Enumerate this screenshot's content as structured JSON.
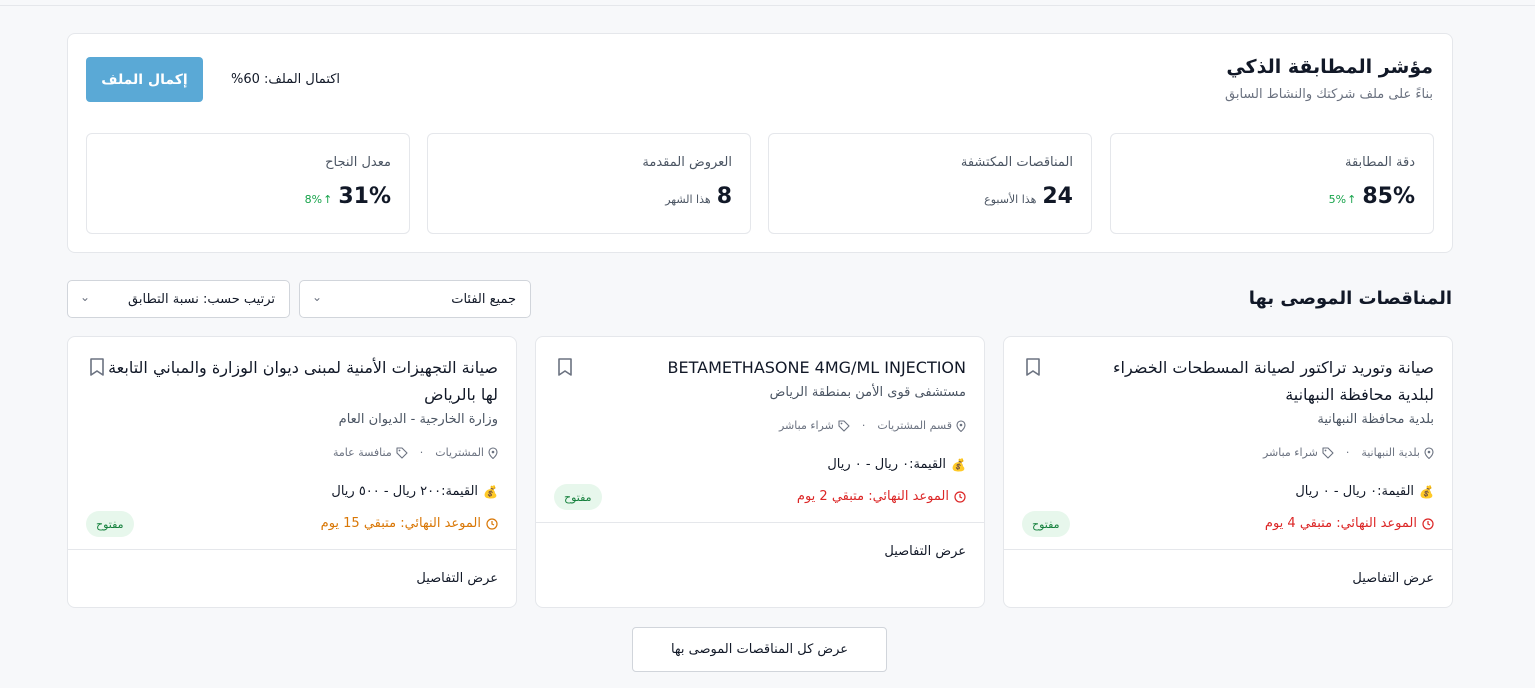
{
  "matching": {
    "title": "مؤشر المطابقة الذكي",
    "subtitle": "بناءً على ملف شركتك والنشاط السابق",
    "completion_label": "اكتمال الملف: 60%",
    "complete_button": "إكمال الملف"
  },
  "stats": [
    {
      "label": "دقة المطابقة",
      "value": "85%",
      "delta": "5%"
    },
    {
      "label": "المناقصات المكتشفة",
      "value": "24",
      "note": "هذا الأسبوع"
    },
    {
      "label": "العروض المقدمة",
      "value": "8",
      "note": "هذا الشهر"
    },
    {
      "label": "معدل النجاح",
      "value": "31%",
      "delta": "8%"
    }
  ],
  "section": {
    "title": "المناقصات الموصى بها",
    "category_filter": "جميع الفئات",
    "sort_filter": "ترتيب حسب: نسبة التطابق"
  },
  "cards": [
    {
      "title": "صيانة وتوريد تراكتور لصيانة المسطحات الخضراء لبلدية محافظة النبهانية",
      "org": "بلدية محافظة النبهانية",
      "location": "بلدية النبهانية",
      "type": "شراء مباشر",
      "value": "القيمة:٠ ريال - ٠ ريال",
      "deadline": "الموعد النهائي: متبقي 4 يوم",
      "deadline_color": "#dc2626",
      "status": "مفتوح",
      "details": "عرض التفاصيل"
    },
    {
      "title": "BETAMETHASONE 4MG/ML INJECTION",
      "org": "مستشفى قوى الأمن بمنطقة الرياض",
      "location": "قسم المشتريات",
      "type": "شراء مباشر",
      "value": "القيمة:٠ ريال - ٠ ريال",
      "deadline": "الموعد النهائي: متبقي 2 يوم",
      "deadline_color": "#dc2626",
      "status": "مفتوح",
      "details": "عرض التفاصيل"
    },
    {
      "title": "صيانة التجهيزات الأمنية لمبنى ديوان الوزارة والمباني التابعة لها بالرياض",
      "org": "وزارة الخارجية - الديوان العام",
      "location": "المشتريات",
      "type": "منافسة عامة",
      "value": "القيمة:٢٠٠ ريال - ٥٠٠ ريال",
      "deadline": "الموعد النهائي: متبقي 15 يوم",
      "deadline_color": "#d97706",
      "status": "مفتوح",
      "details": "عرض التفاصيل"
    }
  ],
  "view_all": "عرض كل المناقصات الموصى بها",
  "colors": {
    "accent": "#5aa9d6",
    "success": "#16a34a",
    "danger": "#dc2626",
    "warning": "#d97706"
  }
}
